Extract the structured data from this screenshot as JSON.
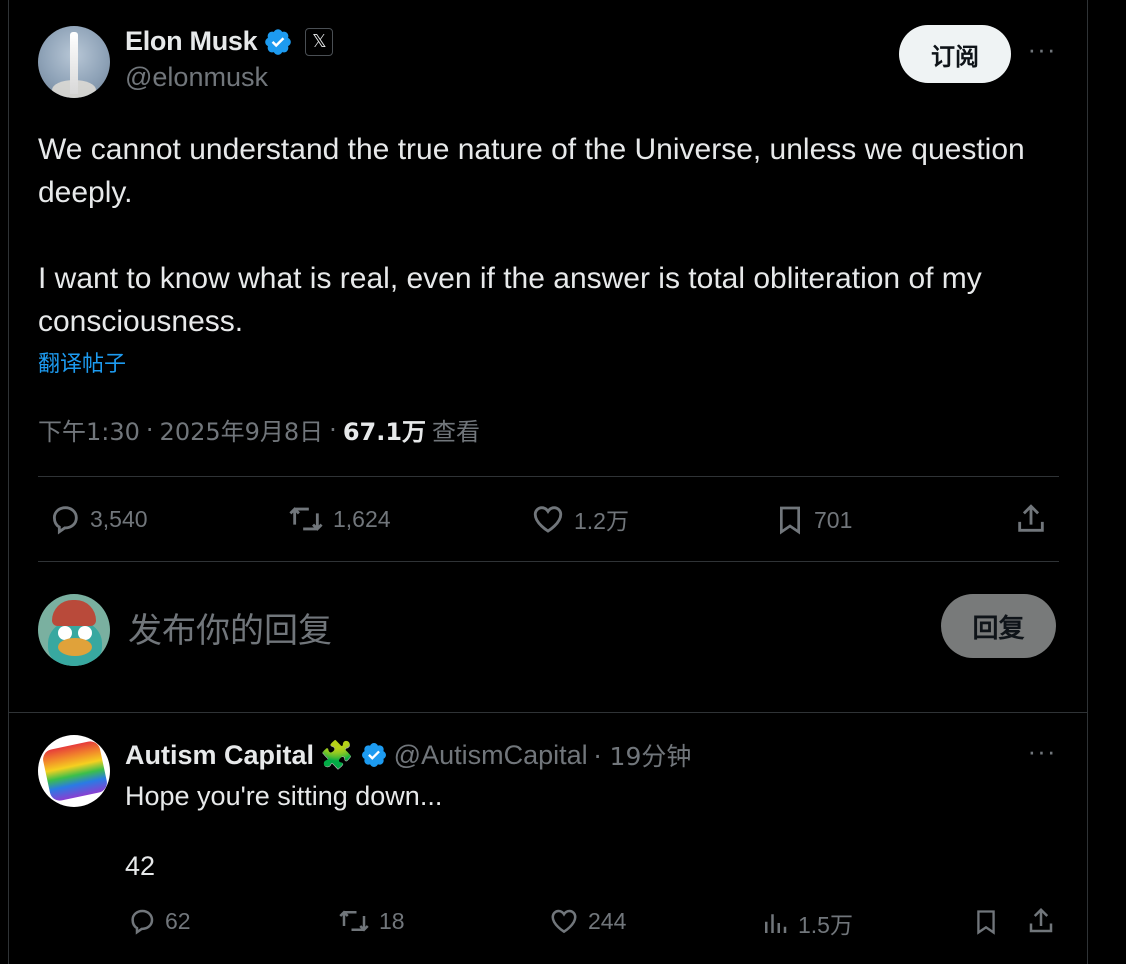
{
  "post": {
    "author": {
      "name": "Elon Musk",
      "handle": "@elonmusk",
      "verified": true,
      "affiliate_badge": "𝕏"
    },
    "subscribe_label": "订阅",
    "more_label": "···",
    "text_paragraphs": [
      "We cannot understand the true nature of the Universe, unless we question deeply.",
      "I want to know what is real, even if the answer is total obliteration of my consciousness."
    ],
    "translate_label": "翻译帖子",
    "meta": {
      "time": "下午1:30",
      "sep1": "·",
      "date": "2025年9月8日",
      "sep2": "·",
      "views": "67.1万",
      "views_label": "查看"
    },
    "actions": {
      "replies": "3,540",
      "reposts": "1,624",
      "likes": "1.2万",
      "bookmarks": "701"
    }
  },
  "composer": {
    "placeholder": "发布你的回复",
    "reply_button": "回复"
  },
  "reply": {
    "author": {
      "name": "Autism Capital",
      "emoji": "🧩",
      "handle": "@AutismCapital",
      "time": "· 19分钟",
      "verified": true
    },
    "more_label": "···",
    "text_paragraphs": [
      "Hope you're sitting down...",
      "42"
    ],
    "actions": {
      "replies": "62",
      "reposts": "18",
      "likes": "244",
      "views": "1.5万"
    }
  },
  "colors": {
    "background": "#000000",
    "text": "#e7e9ea",
    "secondary": "#71767b",
    "accent": "#1d9bf0",
    "border": "#2f3336"
  }
}
